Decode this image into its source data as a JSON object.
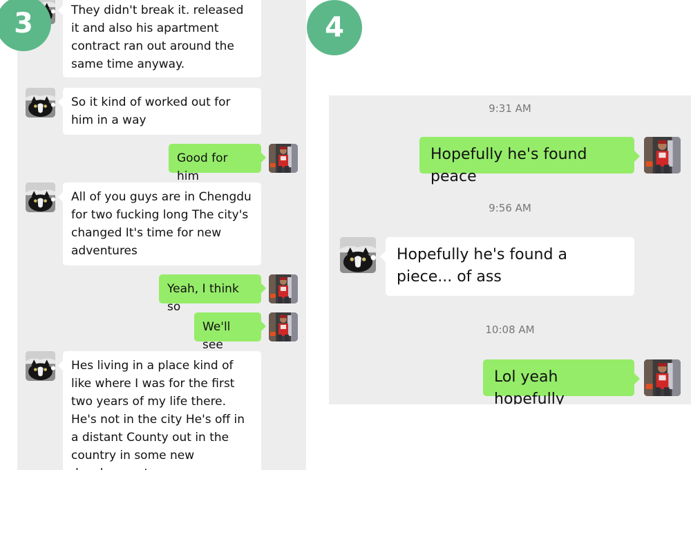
{
  "badges": {
    "left": "3",
    "right": "4"
  },
  "panel3": {
    "messages": [
      {
        "sender": "other",
        "text": "They didn't break it.  released it and also his apartment contract ran out around the same time anyway."
      },
      {
        "sender": "other",
        "text": "So it kind of worked out for him in a way"
      },
      {
        "sender": "me",
        "text": "Good for him"
      },
      {
        "sender": "other",
        "text": "All of you guys are in Chengdu for two fucking long The city's changed It's time for new adventures"
      },
      {
        "sender": "me",
        "text": "Yeah, I think so"
      },
      {
        "sender": "me",
        "text": "We'll see"
      },
      {
        "sender": "other",
        "text": "Hes living in a place kind of like where I was for the first two years of my life there. He's not in the city He's off in a distant County out in the country in some new development."
      }
    ]
  },
  "panel4": {
    "times": [
      "9:31 AM",
      "9:56 AM",
      "10:08 AM"
    ],
    "messages": [
      {
        "sender": "me",
        "text": "Hopefully he's found peace"
      },
      {
        "sender": "other",
        "text": "Hopefully he's found a piece... of ass"
      },
      {
        "sender": "me",
        "text": "Lol yeah hopefully"
      }
    ]
  },
  "colors": {
    "panel_bg": "#ededed",
    "outgoing_bubble": "#95ec69",
    "incoming_bubble": "#ffffff",
    "badge": "#5cb889",
    "timestamp": "#777777"
  },
  "icons": {
    "other_avatar": "cat-avatar-icon",
    "my_avatar": "person-photo-avatar-icon"
  }
}
